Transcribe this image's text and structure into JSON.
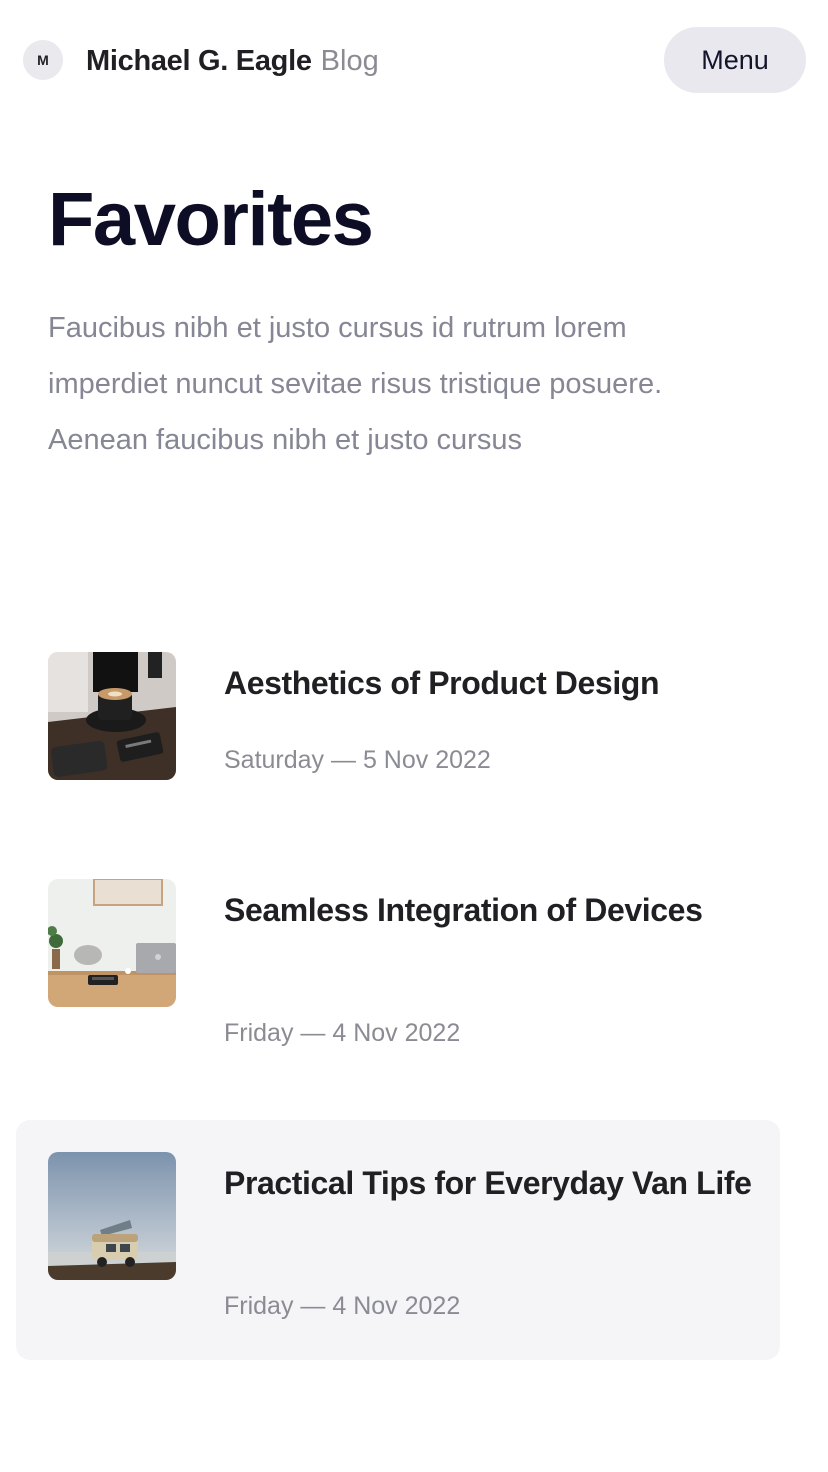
{
  "header": {
    "avatar_initial": "M",
    "brand_name": "Michael G. Eagle",
    "brand_suffix": "Blog",
    "menu_label": "Menu"
  },
  "main": {
    "title": "Favorites",
    "intro": "Faucibus nibh et justo cursus id rutrum lorem imperdiet nuncut sevitae risus tristique posuere. Aenean faucibus nibh et justo cursus"
  },
  "posts": [
    {
      "title": "Aesthetics of Product Design",
      "date": "Saturday — 5 Nov 2022",
      "thumbnail": "coffee-desk-image"
    },
    {
      "title": "Seamless Integration of Devices",
      "date": "Friday — 4 Nov 2022",
      "thumbnail": "workspace-laptop-image"
    },
    {
      "title": "Practical Tips for Everyday Van Life",
      "date": "Friday — 4 Nov 2022",
      "thumbnail": "van-landscape-image"
    }
  ],
  "colors": {
    "heading": "#0d0d26",
    "muted_text": "#868694",
    "menu_bg": "#e8e8ee",
    "highlight_bg": "#f5f5f8"
  }
}
